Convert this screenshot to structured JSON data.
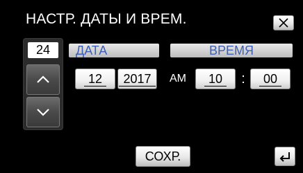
{
  "header": {
    "title": "НАСТР. ДАТЫ И ВРЕМ."
  },
  "stepper": {
    "value": "24"
  },
  "date": {
    "label": "ДАТА",
    "month": "12",
    "year": "2017"
  },
  "time": {
    "label": "ВРЕМЯ",
    "ampm": "AM",
    "hour": "10",
    "separator": ":",
    "minute": "00"
  },
  "footer": {
    "save_label": "СОХР."
  },
  "colors": {
    "label_blue": "#3e5fb5",
    "background": "#000000",
    "stepper_bg": "#2b2b2b"
  }
}
